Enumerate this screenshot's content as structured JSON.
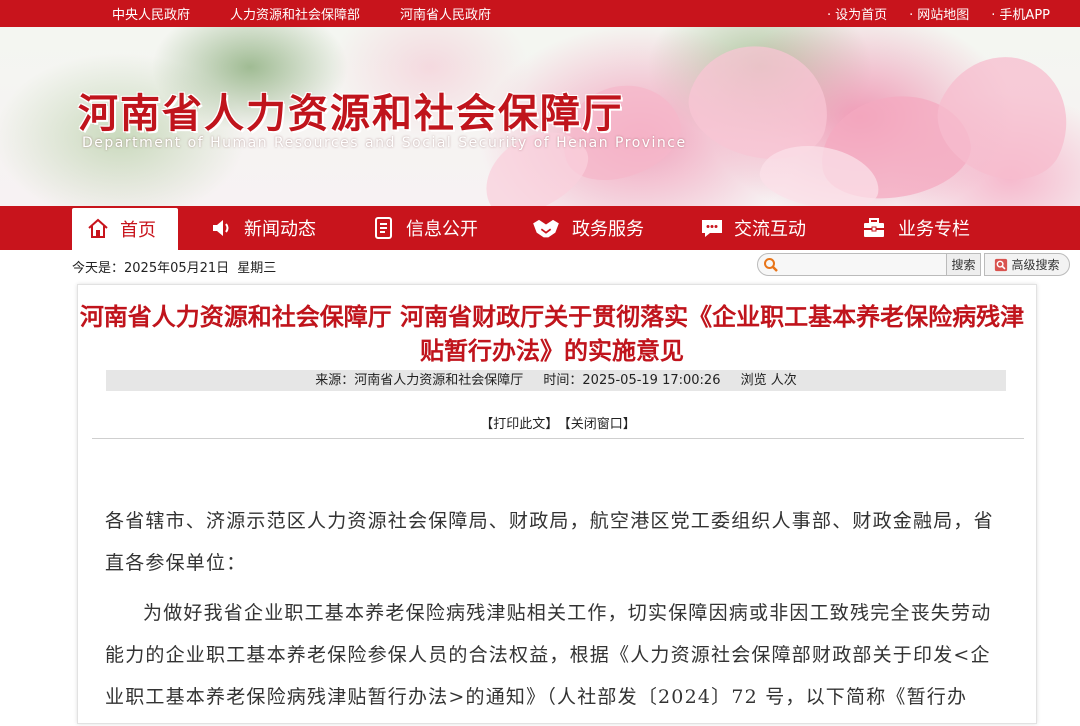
{
  "top_links_left": [
    "中央人民政府",
    "人力资源和社会保障部",
    "河南省人民政府"
  ],
  "top_links_right": [
    "设为首页",
    "网站地图",
    "手机APP"
  ],
  "site": {
    "title": "河南省人力资源和社会保障厅",
    "subtitle": "Department of Human Resources and Social Security of Henan Province"
  },
  "nav": [
    {
      "label": "首页",
      "icon": "home-icon"
    },
    {
      "label": "新闻动态",
      "icon": "speaker-icon"
    },
    {
      "label": "信息公开",
      "icon": "document-icon"
    },
    {
      "label": "政务服务",
      "icon": "handshake-icon"
    },
    {
      "label": "交流互动",
      "icon": "chat-icon"
    },
    {
      "label": "业务专栏",
      "icon": "briefcase-icon"
    }
  ],
  "date": {
    "label": "今天是：",
    "value": "2025年05月21日",
    "weekday": "星期三"
  },
  "search": {
    "placeholder": "",
    "button": "搜索",
    "advanced": "高级搜索"
  },
  "article": {
    "title": "河南省人力资源和社会保障厅 河南省财政厅关于贯彻落实《企业职工基本养老保险病残津贴暂行办法》的实施意见",
    "source_label": "来源：",
    "source": "河南省人力资源和社会保障厅",
    "time_label": "时间：",
    "time": "2025-05-19 17:00:26",
    "views": "浏览 人次",
    "print": "【打印此文】",
    "close": "【关闭窗口】",
    "paragraphs": [
      "各省辖市、济源示范区人力资源社会保障局、财政局，航空港区党工委组织人事部、财政金融局，省直各参保单位：",
      "为做好我省企业职工基本养老保险病残津贴相关工作，切实保障因病或非因工致残完全丧失劳动能力的企业职工基本养老保险参保人员的合法权益，根据《人力资源社会保障部财政部关于印发<企业职工基本养老保险病残津贴暂行办法>的通知》（人社部发〔2024〕72 号，以下简称《暂行办"
    ]
  },
  "colors": {
    "brand_red": "#c8141c",
    "title_red": "#c0141c"
  }
}
